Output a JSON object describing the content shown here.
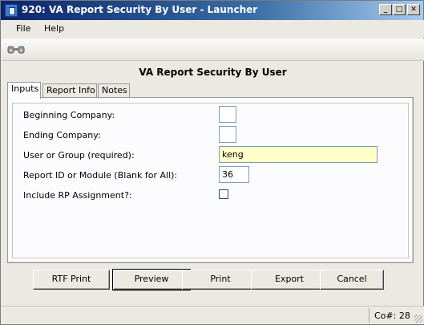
{
  "window": {
    "title": "920: VA Report Security By User - Launcher",
    "minimize_glyph": "_",
    "maximize_glyph": "□",
    "close_glyph": "✕"
  },
  "menu": {
    "items": [
      "File",
      "Help"
    ]
  },
  "toolbar": {
    "icons": [
      "binoculars-icon"
    ]
  },
  "form": {
    "title": "VA Report Security By User"
  },
  "tabs": [
    "Inputs",
    "Report Info",
    "Notes"
  ],
  "fields": {
    "beginning_company": {
      "label": "Beginning Company:",
      "value": ""
    },
    "ending_company": {
      "label": "Ending Company:",
      "value": ""
    },
    "user_or_group": {
      "label": "User or Group (required):",
      "value": "keng"
    },
    "report_id": {
      "label": "Report ID or Module (Blank for All):",
      "value": "36"
    },
    "include_rp": {
      "label": "Include RP Assignment?:",
      "checked": false
    }
  },
  "buttons": {
    "rtf_print": "RTF Print",
    "preview": "Preview",
    "print": "Print",
    "export": "Export",
    "cancel": "Cancel"
  },
  "status": {
    "company": "Co#: 28"
  },
  "colors": {
    "title_gradient_start": "#0a246a",
    "title_gradient_end": "#a6caf0",
    "required_field_bg": "#ffffc8"
  }
}
